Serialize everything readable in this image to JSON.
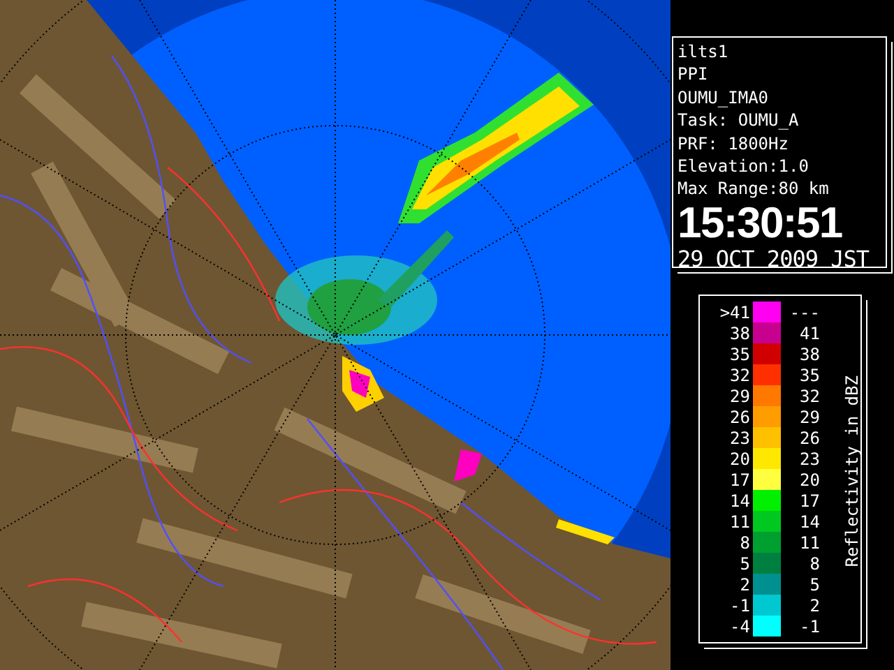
{
  "info": {
    "lines": [
      "ilts1",
      "PPI",
      "OUMU_IMA0",
      "Task: OUMU_A",
      "PRF: 1800Hz",
      "Elevation:1.0",
      "Max Range:80 km"
    ],
    "time": "15:30:51",
    "date": "29 OCT 2009 JST"
  },
  "legend": {
    "title": "Reflectivity in dBZ",
    "rows": [
      {
        "low": ">41",
        "high": "---",
        "color": "#ff00f0"
      },
      {
        "low": "38",
        "high": "41",
        "color": "#c80090"
      },
      {
        "low": "35",
        "high": "38",
        "color": "#d00000"
      },
      {
        "low": "32",
        "high": "35",
        "color": "#ff3000"
      },
      {
        "low": "29",
        "high": "32",
        "color": "#ff7800"
      },
      {
        "low": "26",
        "high": "29",
        "color": "#ff9c00"
      },
      {
        "low": "23",
        "high": "26",
        "color": "#ffc000"
      },
      {
        "low": "20",
        "high": "23",
        "color": "#ffe800"
      },
      {
        "low": "17",
        "high": "20",
        "color": "#ffff40"
      },
      {
        "low": "14",
        "high": "17",
        "color": "#00f000"
      },
      {
        "low": "11",
        "high": "14",
        "color": "#00c820"
      },
      {
        "low": "8",
        "high": "11",
        "color": "#00a030"
      },
      {
        "low": "5",
        "high": "8",
        "color": "#008040"
      },
      {
        "low": "2",
        "high": "5",
        "color": "#009090"
      },
      {
        "low": "-1",
        "high": "2",
        "color": "#00c8d0"
      },
      {
        "low": "-4",
        "high": "-1",
        "color": "#00ffff"
      }
    ]
  }
}
